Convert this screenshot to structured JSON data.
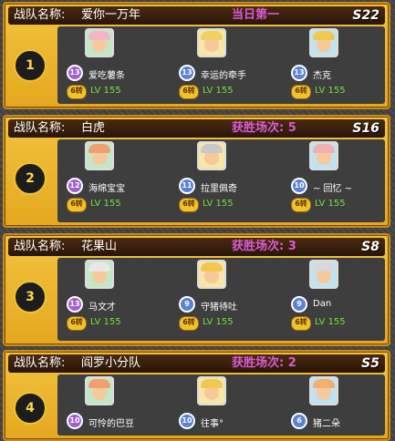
{
  "team_label": "战队名称:",
  "teams": [
    {
      "rank": "1",
      "name": "爱你一万年",
      "status": "当日第一",
      "server": "S22",
      "members": [
        {
          "name": "爱吃薯条",
          "level": "LV 155",
          "star": "6转",
          "badge": "13"
        },
        {
          "name": "幸运的牵手",
          "level": "LV 155",
          "star": "6转",
          "badge": "13"
        },
        {
          "name": "杰克",
          "level": "LV 155",
          "star": "6转",
          "badge": "13"
        }
      ]
    },
    {
      "rank": "2",
      "name": "白虎",
      "status": "获胜场次: 5",
      "server": "S16",
      "members": [
        {
          "name": "海绵宝宝",
          "level": "LV 155",
          "star": "6转",
          "badge": "12"
        },
        {
          "name": "拉里佩奇",
          "level": "LV 155",
          "star": "6转",
          "badge": "11"
        },
        {
          "name": "~ 回忆 ~",
          "level": "LV 155",
          "star": "6转",
          "badge": "10"
        }
      ]
    },
    {
      "rank": "3",
      "name": "花果山",
      "status": "获胜场次: 3",
      "server": "S8",
      "members": [
        {
          "name": "马文才",
          "level": "LV 155",
          "star": "6转",
          "badge": "13"
        },
        {
          "name": "守猪待吐",
          "level": "LV 155",
          "star": "6转",
          "badge": "9"
        },
        {
          "name": "Dan",
          "level": "LV 155",
          "star": "6转",
          "badge": "9"
        }
      ]
    },
    {
      "rank": "4",
      "name": "阎罗小分队",
      "status": "获胜场次: 2",
      "server": "S5",
      "members": [
        {
          "name": "可怜的巴豆",
          "level": "",
          "star": "",
          "badge": "10"
        },
        {
          "name": "往事°",
          "level": "",
          "star": "",
          "badge": "10"
        },
        {
          "name": "猪二朵",
          "level": "",
          "star": "",
          "badge": "6"
        }
      ]
    }
  ]
}
